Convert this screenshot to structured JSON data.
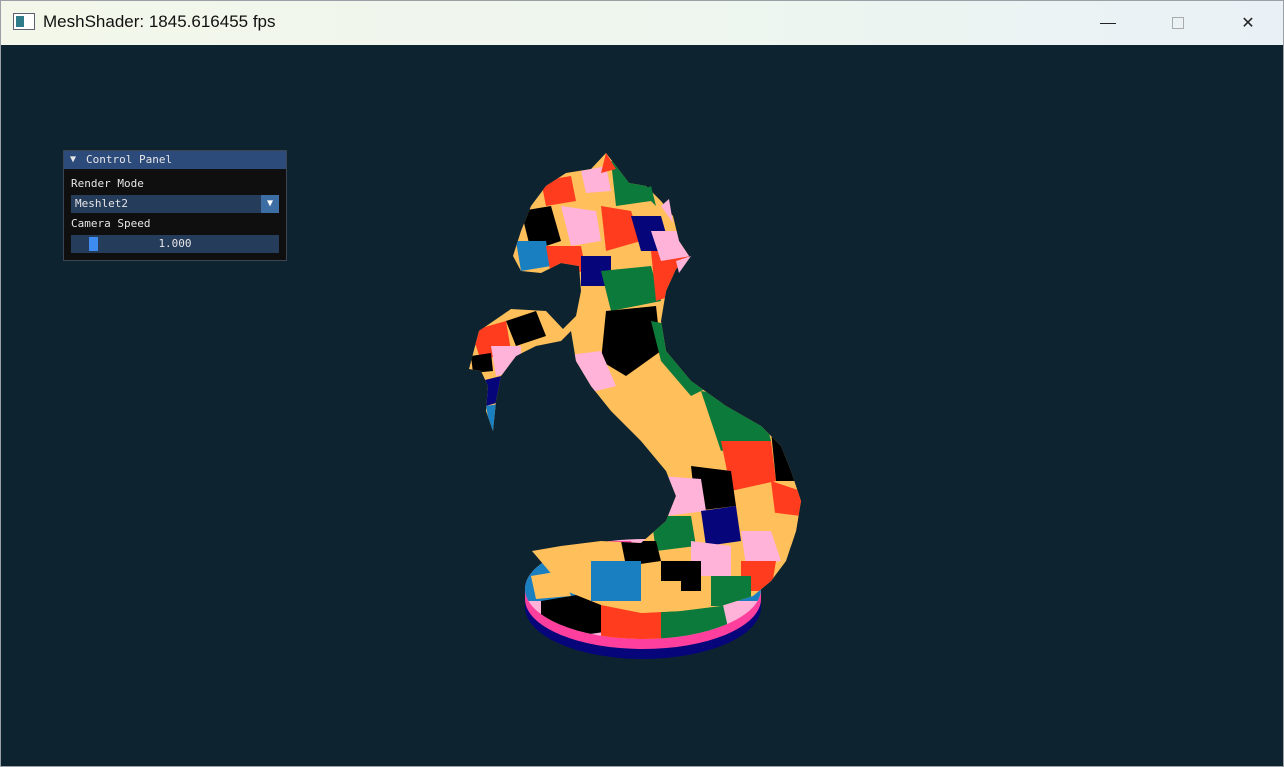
{
  "window": {
    "title": "MeshShader: 1845.616455 fps",
    "controls": {
      "minimize": "—",
      "maximize": "□",
      "close": "✕"
    }
  },
  "control_panel": {
    "title": "Control Panel",
    "collapse_icon": "▼",
    "render_mode_label": "Render Mode",
    "render_mode_value": "Meshlet2",
    "dropdown_icon": "▼",
    "camera_speed_label": "Camera Speed",
    "camera_speed_value": "1.000",
    "camera_speed_fraction": 0.08
  },
  "viewport": {
    "object": "horse-statue-meshlet-render",
    "background_color": "#0d2430",
    "meshlet_colors": [
      "#ff3c1e",
      "#0b7a3a",
      "#ffbf5a",
      "#ffb3d9",
      "#000000",
      "#06067a",
      "#1a7fc1",
      "#ff3f9d"
    ]
  }
}
